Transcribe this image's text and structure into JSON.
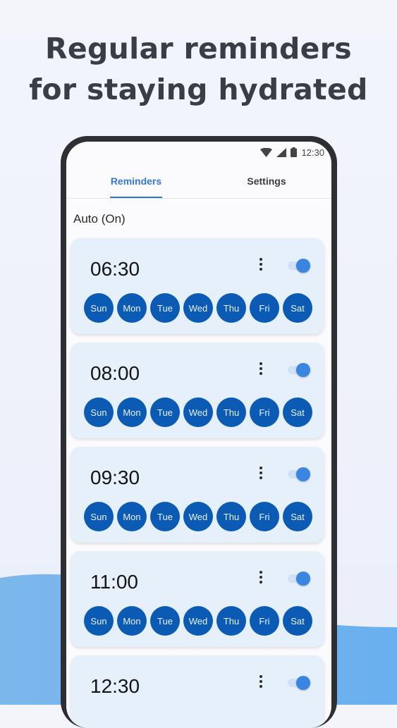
{
  "headline": {
    "line1": "Regular reminders",
    "line2": "for staying hydrated"
  },
  "status_bar": {
    "time": "12:30"
  },
  "tabs": [
    {
      "label": "Reminders",
      "active": true
    },
    {
      "label": "Settings",
      "active": false
    }
  ],
  "auto_label": "Auto (On)",
  "days": [
    "Sun",
    "Mon",
    "Tue",
    "Wed",
    "Thu",
    "Fri",
    "Sat"
  ],
  "reminders": [
    {
      "time": "06:30",
      "enabled": true
    },
    {
      "time": "08:00",
      "enabled": true
    },
    {
      "time": "09:30",
      "enabled": true
    },
    {
      "time": "11:00",
      "enabled": true
    },
    {
      "time": "12:30",
      "enabled": true
    }
  ],
  "colors": {
    "accent": "#3478d4",
    "day_chip": "#0b5bb4",
    "card_bg": "#e5f0fb",
    "toggle_thumb": "#3a85e0"
  }
}
